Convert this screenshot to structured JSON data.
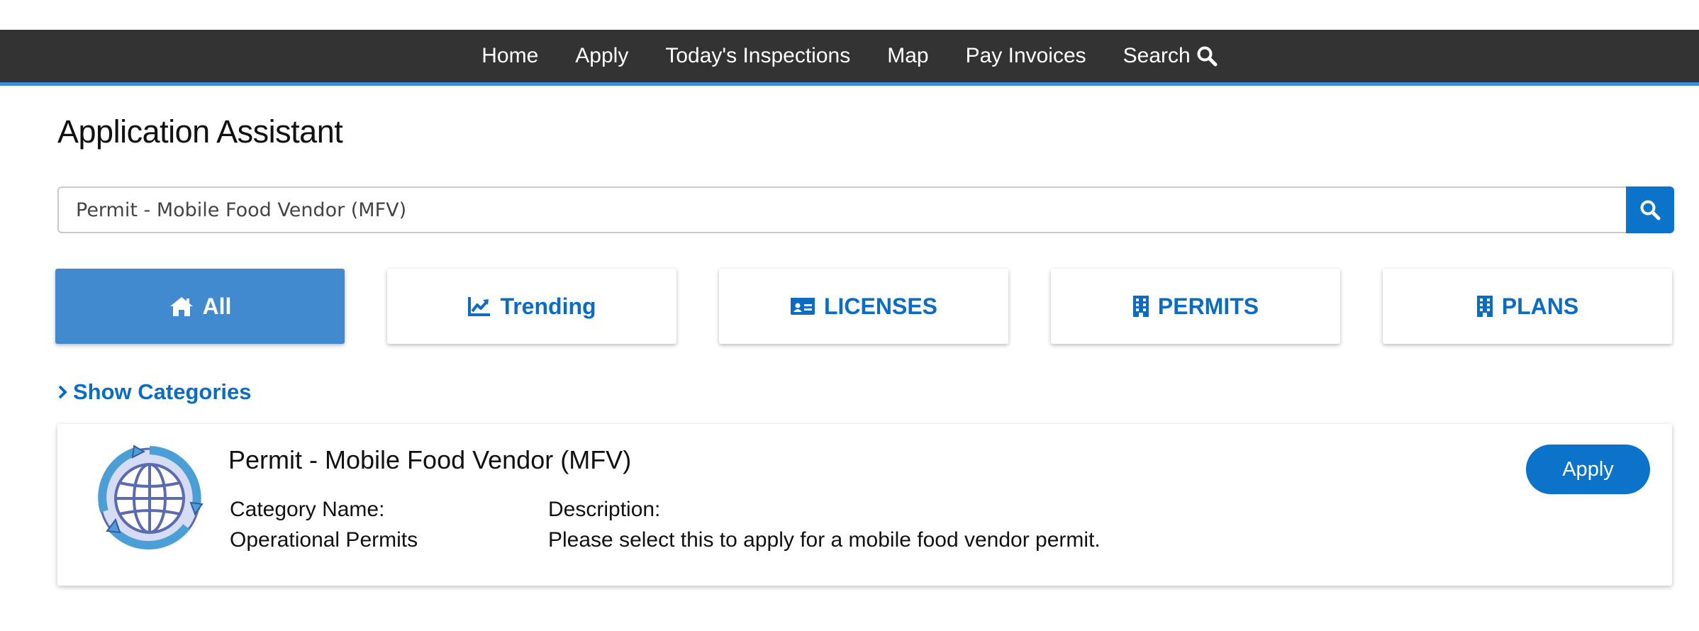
{
  "nav": {
    "items": [
      {
        "label": "Home"
      },
      {
        "label": "Apply"
      },
      {
        "label": "Today's Inspections"
      },
      {
        "label": "Map"
      },
      {
        "label": "Pay Invoices"
      },
      {
        "label": "Search",
        "icon": "search-icon"
      }
    ]
  },
  "page": {
    "title": "Application Assistant"
  },
  "search": {
    "value": "Permit - Mobile Food Vendor (MFV)",
    "button_icon": "search-icon"
  },
  "tabs": [
    {
      "label": "All",
      "icon": "home-icon",
      "active": true
    },
    {
      "label": "Trending",
      "icon": "trending-chart-icon",
      "active": false
    },
    {
      "label": "LICENSES",
      "icon": "id-card-icon",
      "active": false
    },
    {
      "label": "PERMITS",
      "icon": "building-icon",
      "active": false
    },
    {
      "label": "PLANS",
      "icon": "building-icon",
      "active": false
    }
  ],
  "show_categories": {
    "label": "Show Categories",
    "icon": "chevron-right-icon"
  },
  "result": {
    "title": "Permit - Mobile Food Vendor (MFV)",
    "icon": "globe-cycle-icon",
    "category_label": "Category Name:",
    "category_value": "Operational Permits",
    "description_label": "Description:",
    "description_value": "Please select this to apply for a mobile food vendor permit.",
    "apply_label": "Apply"
  },
  "colors": {
    "nav_bg": "#333333",
    "nav_accent": "#3a8fdd",
    "primary": "#0b73c9",
    "active_tab": "#418ad0",
    "link": "#0b6cc2"
  }
}
